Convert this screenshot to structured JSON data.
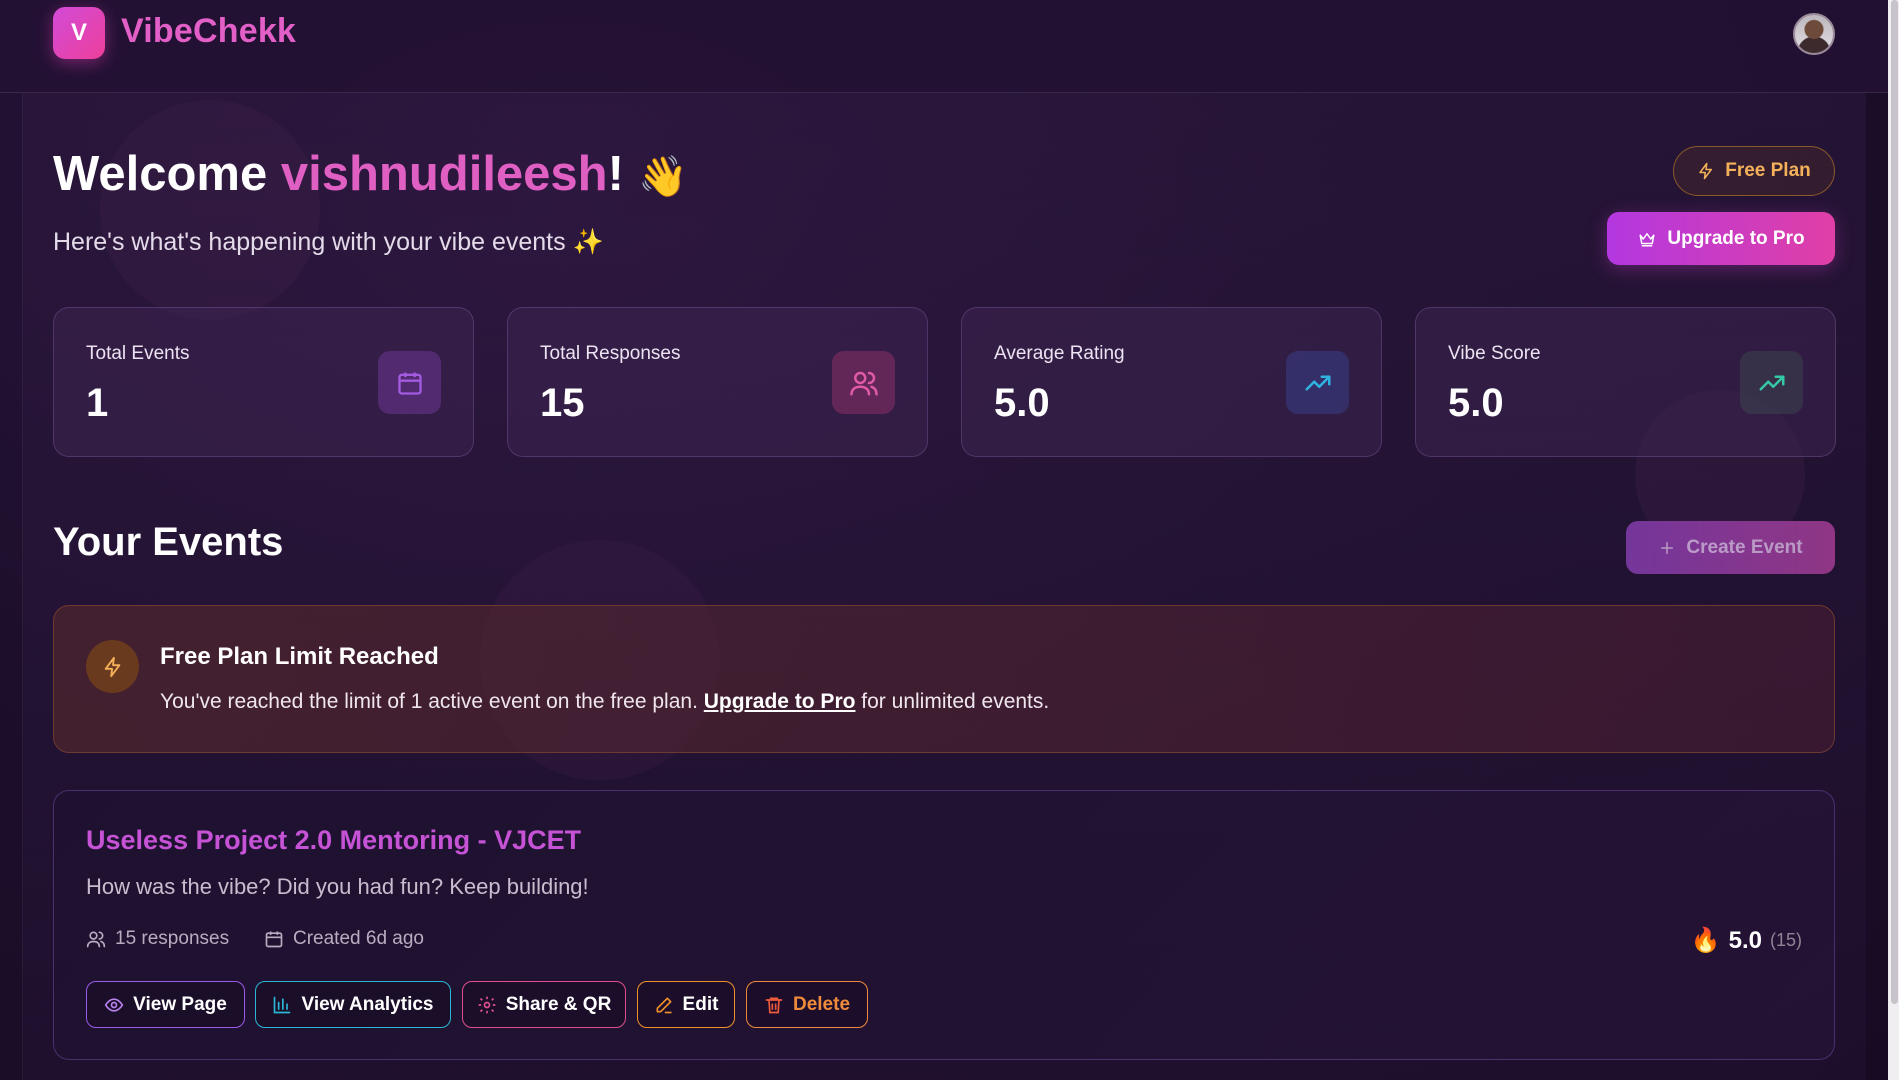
{
  "app": {
    "logo_letter": "V",
    "name": "VibeChekk"
  },
  "header": {
    "avatar": "user-avatar"
  },
  "welcome": {
    "greeting": "Welcome",
    "username": "vishnudileesh",
    "punctuation": "!",
    "wave": "👋",
    "subtitle": "Here's what's happening with your vibe events ✨"
  },
  "plan": {
    "badge_label": "Free Plan",
    "upgrade_label": "Upgrade to Pro"
  },
  "stats": [
    {
      "label": "Total Events",
      "value": "1",
      "icon": "calendar-icon",
      "color": "#a35be0"
    },
    {
      "label": "Total Responses",
      "value": "15",
      "icon": "users-icon",
      "color": "#e05aa8"
    },
    {
      "label": "Average Rating",
      "value": "5.0",
      "icon": "trending-up-icon",
      "color": "#2fb3e0"
    },
    {
      "label": "Vibe Score",
      "value": "5.0",
      "icon": "trending-up-icon",
      "color": "#36c9a5"
    }
  ],
  "events_section": {
    "title": "Your Events",
    "create_label": "Create Event"
  },
  "limit_banner": {
    "title": "Free Plan Limit Reached",
    "text_before": "You've reached the limit of 1 active event on the free plan.",
    "link_text": "Upgrade to Pro",
    "text_after": "for unlimited events."
  },
  "event": {
    "title": "Useless Project 2.0 Mentoring - VJCET",
    "description": "How was the vibe? Did you had fun? Keep building!",
    "responses": "15 responses",
    "created": "Created 6d ago",
    "rating_value": "5.0",
    "rating_count": "(15)",
    "actions": {
      "view_page": "View Page",
      "view_analytics": "View Analytics",
      "share_qr": "Share & QR",
      "edit": "Edit",
      "delete": "Delete"
    }
  },
  "colors": {
    "brand": "#e15fc6",
    "free_plan": "#f4b15a",
    "view_page_border": "#9b5ae8",
    "analytics_border": "#2bb6d4",
    "share_border": "#e0508e",
    "edit_border": "#f0902b",
    "delete_border": "#ef8a3c"
  }
}
